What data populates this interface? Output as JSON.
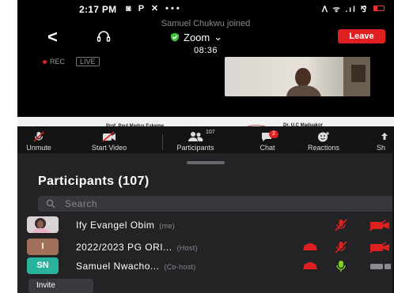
{
  "status_bar": {
    "time": "2:17 PM",
    "left_icons": "◙ P ✕ •••",
    "right_icons": "ᐱ ᯤ .ıl ⅋̈"
  },
  "notification": "Samuel Chukwu joined",
  "meeting": {
    "title": "Zoom",
    "chevron": "⌄",
    "timer": "08:36",
    "leave_label": "Leave",
    "back_glyph": "<"
  },
  "recording": {
    "rec_label": "REC",
    "live_label": "LIVE"
  },
  "shared_strip": {
    "left_text": "Prof. Paul Madus Eskeme",
    "right_text": "Dr. U.C Maduakor"
  },
  "toolbar": {
    "items": [
      {
        "label": "Unmute",
        "icon": "mic-off-icon"
      },
      {
        "label": "Start Video",
        "icon": "video-off-icon"
      },
      {
        "label": "Participants",
        "icon": "participants-icon",
        "count": "107"
      },
      {
        "label": "Chat",
        "icon": "chat-icon",
        "badge": "2"
      },
      {
        "label": "Reactions",
        "icon": "reactions-icon"
      },
      {
        "label": "Sh",
        "icon": "share-icon"
      }
    ]
  },
  "participants_panel": {
    "title": "Participants (107)",
    "search_placeholder": "Search",
    "participants": [
      {
        "name": "Ify Evangel Obim",
        "role": "(me)",
        "avatar_type": "photo",
        "avatar_text": ""
      },
      {
        "name": "2022/2023 PG ORI...",
        "role": "(Host)",
        "avatar_type": "initial",
        "avatar_text": "I",
        "avatar_color": "#a0705a"
      },
      {
        "name": "Samuel Nwacho...",
        "role": "(Co-host)",
        "avatar_type": "initial",
        "avatar_text": "SN",
        "avatar_color": "#2ab39c"
      }
    ],
    "invite_label": "Invite"
  },
  "colors": {
    "leave_red": "#e02020",
    "muted_red": "#e02020",
    "unmuted_green": "#7ed321",
    "sheet_bg": "#232325"
  }
}
